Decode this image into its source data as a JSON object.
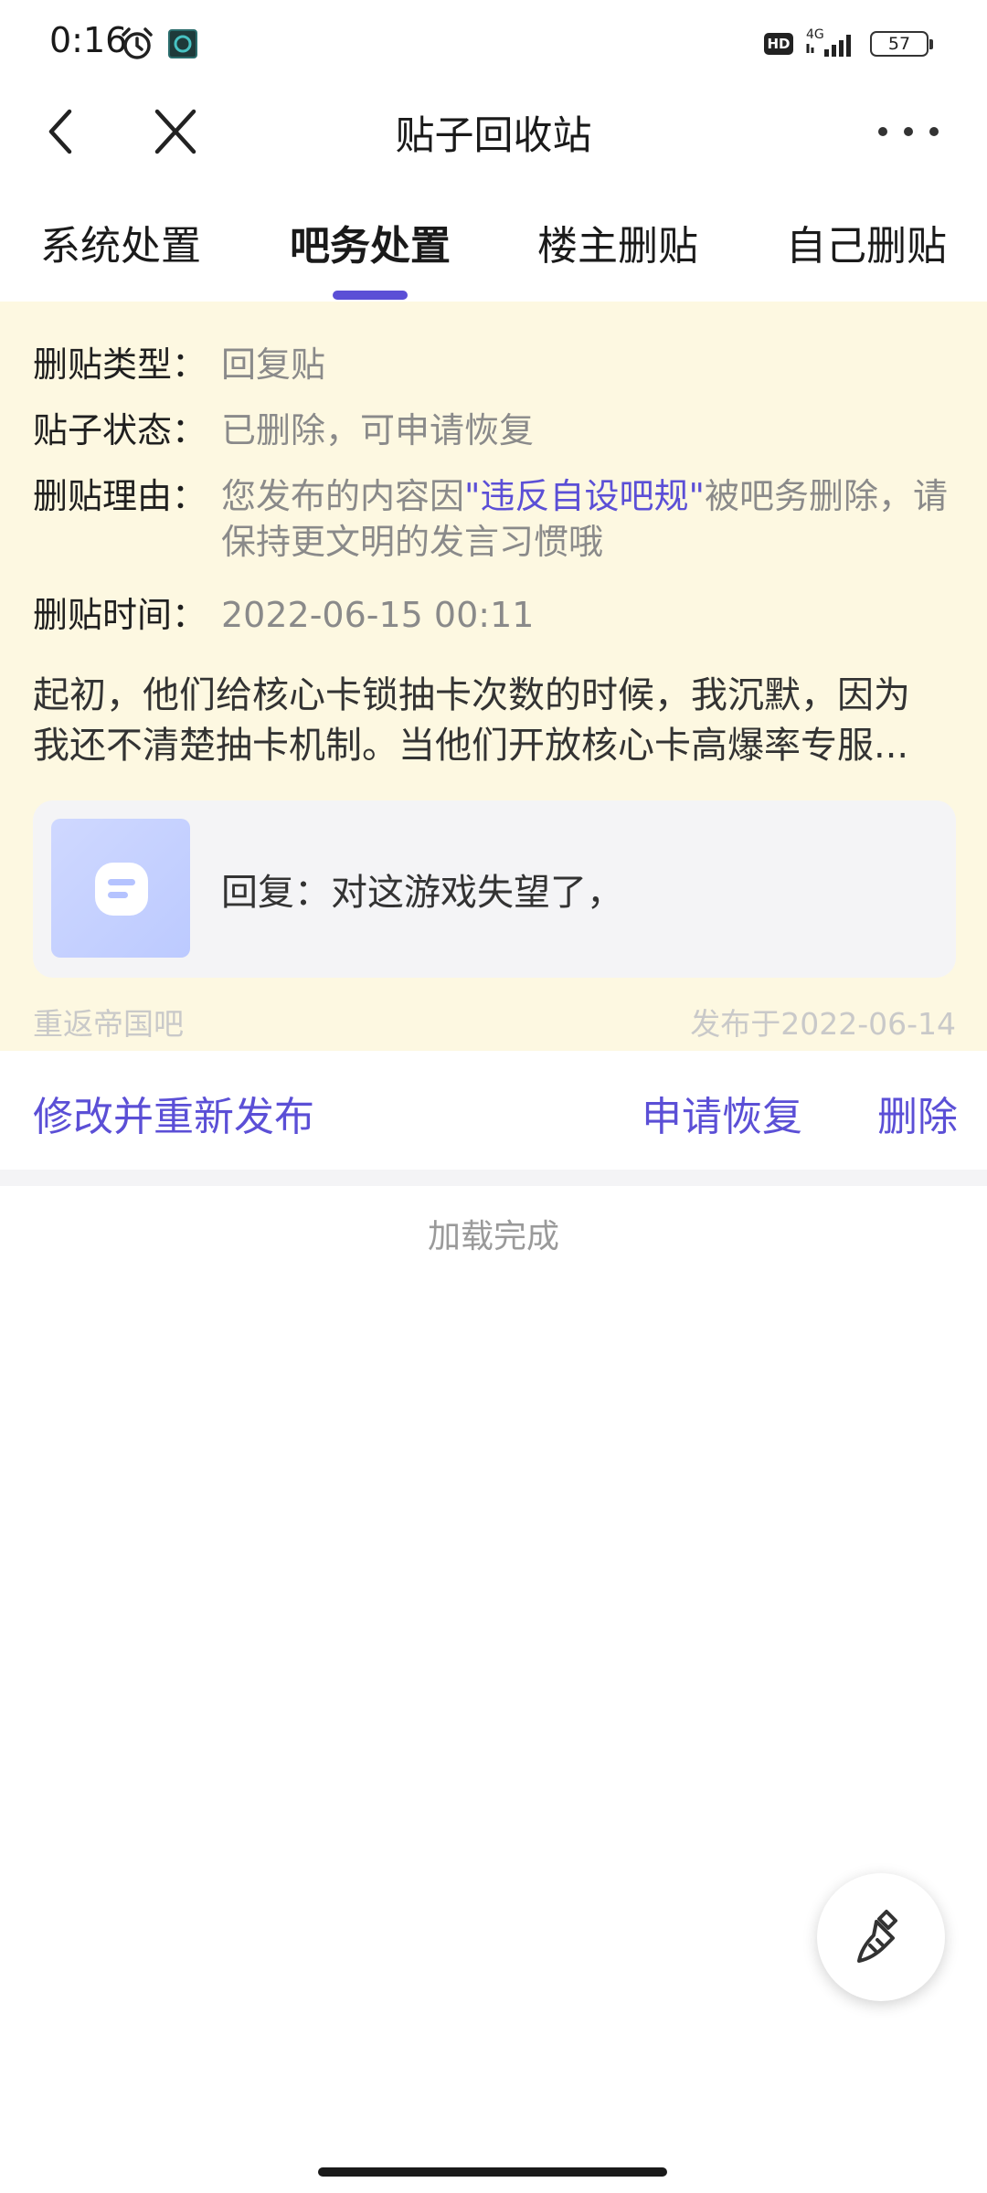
{
  "status_bar": {
    "time": "0:16",
    "network": "4G",
    "hd_badge": "HD",
    "battery": "57"
  },
  "nav": {
    "title": "贴子回收站"
  },
  "tabs": [
    {
      "label": "系统处置",
      "active": false
    },
    {
      "label": "吧务处置",
      "active": true
    },
    {
      "label": "楼主删贴",
      "active": false
    },
    {
      "label": "自己删贴",
      "active": false
    }
  ],
  "post": {
    "type_label": "删贴类型：",
    "type_value": "回复贴",
    "status_label": "贴子状态：",
    "status_value": "已删除，可申请恢复",
    "reason_label": "删贴理由：",
    "reason_prefix": "您发布的内容因",
    "reason_rule": "\"违反自设吧规\"",
    "reason_suffix": "被吧务删除，请保持更文明的发言习惯哦",
    "time_label": "删贴时间：",
    "time_value": "2022-06-15 00:11",
    "excerpt_line1": "起初，他们给核心卡锁抽卡次数的时候，我沉默，因为",
    "excerpt_line2": "我还不清楚抽卡机制。当他们开放核心卡高爆率专服...",
    "reply_text": "回复：对这游戏失望了，",
    "forum": "重返帝国吧",
    "published": "发布于2022-06-14"
  },
  "actions": {
    "edit_republish": "修改并重新发布",
    "apply_restore": "申请恢复",
    "delete": "删除"
  },
  "load_status": "加载完成",
  "colors": {
    "accent": "#5b4fd6",
    "card_bg": "#fdf8e1",
    "muted_text": "#8a8a8a"
  }
}
